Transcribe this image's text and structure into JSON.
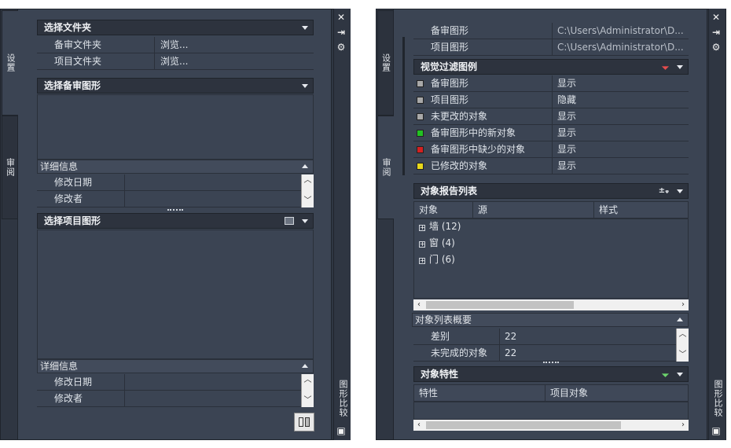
{
  "left_panel": {
    "tabs": {
      "settings": "设置",
      "review": "审阅"
    },
    "folder_section": {
      "title": "选择文件夹",
      "rows": [
        {
          "label": "备审文件夹",
          "value": "浏览..."
        },
        {
          "label": "项目文件夹",
          "value": "浏览..."
        }
      ]
    },
    "review_drawing_section": {
      "title": "选择备审图形"
    },
    "details1": {
      "title": "详细信息",
      "rows": [
        {
          "label": "修改日期",
          "value": ""
        },
        {
          "label": "修改者",
          "value": ""
        }
      ]
    },
    "project_drawing_section": {
      "title": "选择项目图形"
    },
    "details2": {
      "title": "详细信息",
      "rows": [
        {
          "label": "修改日期",
          "value": ""
        },
        {
          "label": "修改者",
          "value": ""
        }
      ]
    },
    "side_label": "图形比较"
  },
  "right_panel": {
    "tabs": {
      "settings": "设置",
      "review": "审阅"
    },
    "paths": [
      {
        "label": "备审图形",
        "value": "C:\\Users\\Administrator\\D..."
      },
      {
        "label": "项目图形",
        "value": "C:\\Users\\Administrator\\D..."
      }
    ],
    "legend_section": {
      "title": "视觉过滤图例",
      "rows": [
        {
          "label": "备审图形",
          "value": "显示",
          "color": "#a9a9a9"
        },
        {
          "label": "项目图形",
          "value": "隐藏",
          "color": "#a9a9a9"
        },
        {
          "label": "未更改的对象",
          "value": "显示",
          "color": "#a9a9a9"
        },
        {
          "label": "备审图形中的新对象",
          "value": "显示",
          "color": "#22c222"
        },
        {
          "label": "备审图形中缺少的对象",
          "value": "显示",
          "color": "#d42020"
        },
        {
          "label": "已修改的对象",
          "value": "显示",
          "color": "#e8d81a"
        }
      ]
    },
    "report_section": {
      "title": "对象报告列表",
      "columns": [
        "对象",
        "源",
        "样式"
      ],
      "items": [
        "墙 (12)",
        "窗 (4)",
        "门 (6)"
      ]
    },
    "summary": {
      "title": "对象列表概要",
      "rows": [
        {
          "label": "差别",
          "value": "22"
        },
        {
          "label": "未完成的对象",
          "value": "22"
        }
      ]
    },
    "props_section": {
      "title": "对象特性",
      "columns": [
        "特性",
        "项目对象"
      ]
    },
    "side_label": "图形比较"
  },
  "colors": {
    "panel_bg": "#3b4453",
    "header_bg": "#2d333e",
    "border": "#20252d"
  }
}
